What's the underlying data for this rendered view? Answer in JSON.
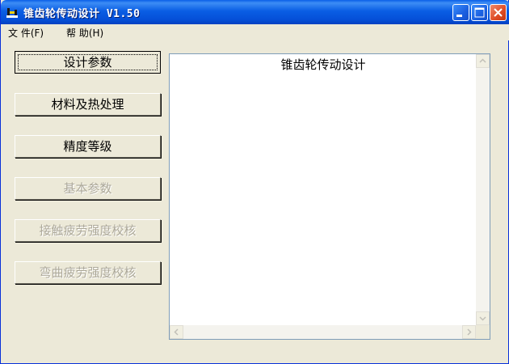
{
  "window": {
    "title": "锥齿轮传动设计  V1.50"
  },
  "menu": {
    "items": [
      "文 件(F)",
      "帮 助(H)"
    ]
  },
  "buttons": [
    {
      "label": "设计参数",
      "state": "focused"
    },
    {
      "label": "材料及热处理",
      "state": "enabled"
    },
    {
      "label": "精度等级",
      "state": "enabled"
    },
    {
      "label": "基本参数",
      "state": "disabled"
    },
    {
      "label": "接触疲劳强度校核",
      "state": "disabled"
    },
    {
      "label": "弯曲疲劳强度校核",
      "state": "disabled"
    }
  ],
  "output": {
    "heading": "锥齿轮传动设计"
  },
  "colors": {
    "titlebar": "#0a5ee4",
    "window_bg": "#ece9d8",
    "disabled_text": "#aca899",
    "close_button": "#de4b24"
  },
  "icons": {
    "app": "app-icon",
    "minimize": "minimize-icon",
    "maximize": "maximize-icon",
    "close": "close-icon"
  }
}
